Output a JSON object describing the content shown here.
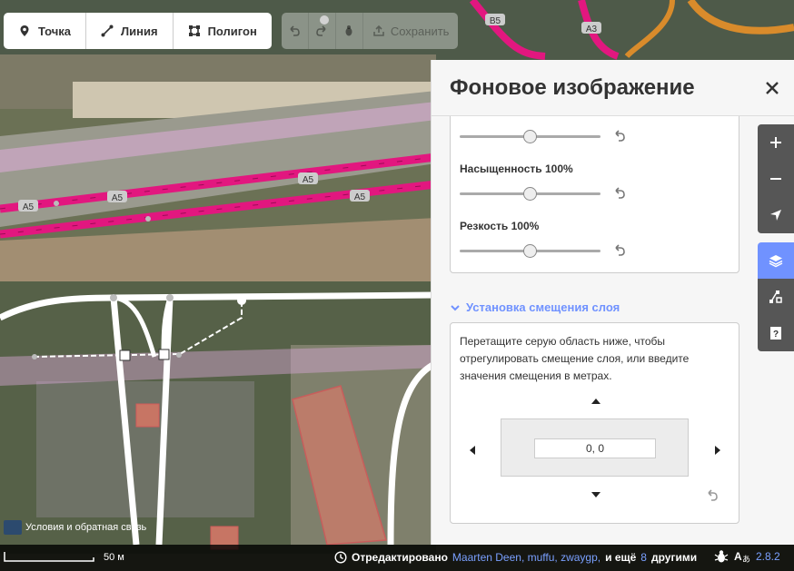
{
  "toolbar": {
    "point_label": "Точка",
    "line_label": "Линия",
    "polygon_label": "Полигон",
    "save_label": "Сохранить"
  },
  "panel": {
    "title": "Фоновое изображение",
    "saturation_label": "Насыщенность 100%",
    "sharpness_label": "Резкость 100%",
    "brightness_value": 0.5,
    "saturation_value": 0.5,
    "sharpness_value": 0.5,
    "offset_section_title": "Установка смещения слоя",
    "offset_instructions": "Перетащите серую область ниже, чтобы отрегулировать смещение слоя, или введите значения смещения в метрах.",
    "offset_value": "0, 0"
  },
  "map": {
    "road_labels": [
      "A5",
      "A5",
      "A5",
      "A5",
      "B5",
      "A3"
    ]
  },
  "footer": {
    "terms_label": "Условия и обратная связь",
    "scale_label": "50 м",
    "edited_prefix": "Отредактировано",
    "editors": "Maarten Deen, muffu, zwaygp,",
    "and_more": "и ещё",
    "more_count": "8",
    "others": "другими",
    "version": "2.8.2"
  },
  "colors": {
    "accent": "#7092ff",
    "motorway": "#e2177f",
    "trunk": "#d98b2b"
  }
}
